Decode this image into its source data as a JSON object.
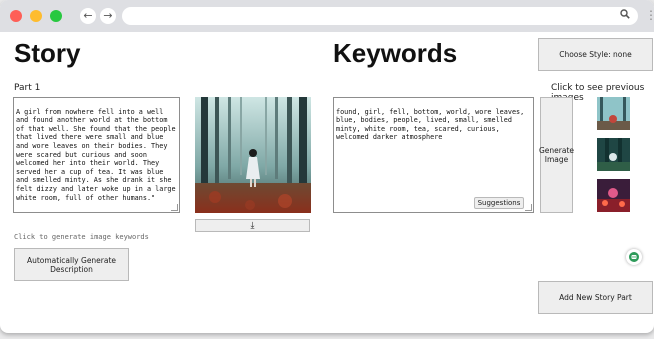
{
  "browser": {
    "back_icon": "←",
    "forward_icon": "→",
    "search_icon": "🔍",
    "menu_icon": "⋮"
  },
  "story": {
    "heading": "Story",
    "part_label": "Part 1",
    "text": "A girl from nowhere fell into a well and found another world at the bottom of that well. She found that the people that lived there were small and blue and wore leaves on their bodies. They were scared but curious and soon welcomed her into their world. They served her a cup of tea. It was blue and smelled minty. As she drank it she felt dizzy and later woke up in a large white room, full of other humans.\"",
    "keywords_hint": "Click to generate image keywords",
    "auto_button": "Automatically Generate Description",
    "download_icon": "⤓"
  },
  "keywords": {
    "heading": "Keywords",
    "text": "found, girl, fell, bottom, world, wore leaves, blue, bodies, people, lived, small, smelled minty, white room, tea, scared, curious, welcomed darker atmosphere",
    "suggestions_button": "Suggestions"
  },
  "side": {
    "style_button": "Choose Style: none",
    "previous_label": "Click to see previous images",
    "generate_button": "Generate Image",
    "add_part_button": "Add New Story Part"
  }
}
